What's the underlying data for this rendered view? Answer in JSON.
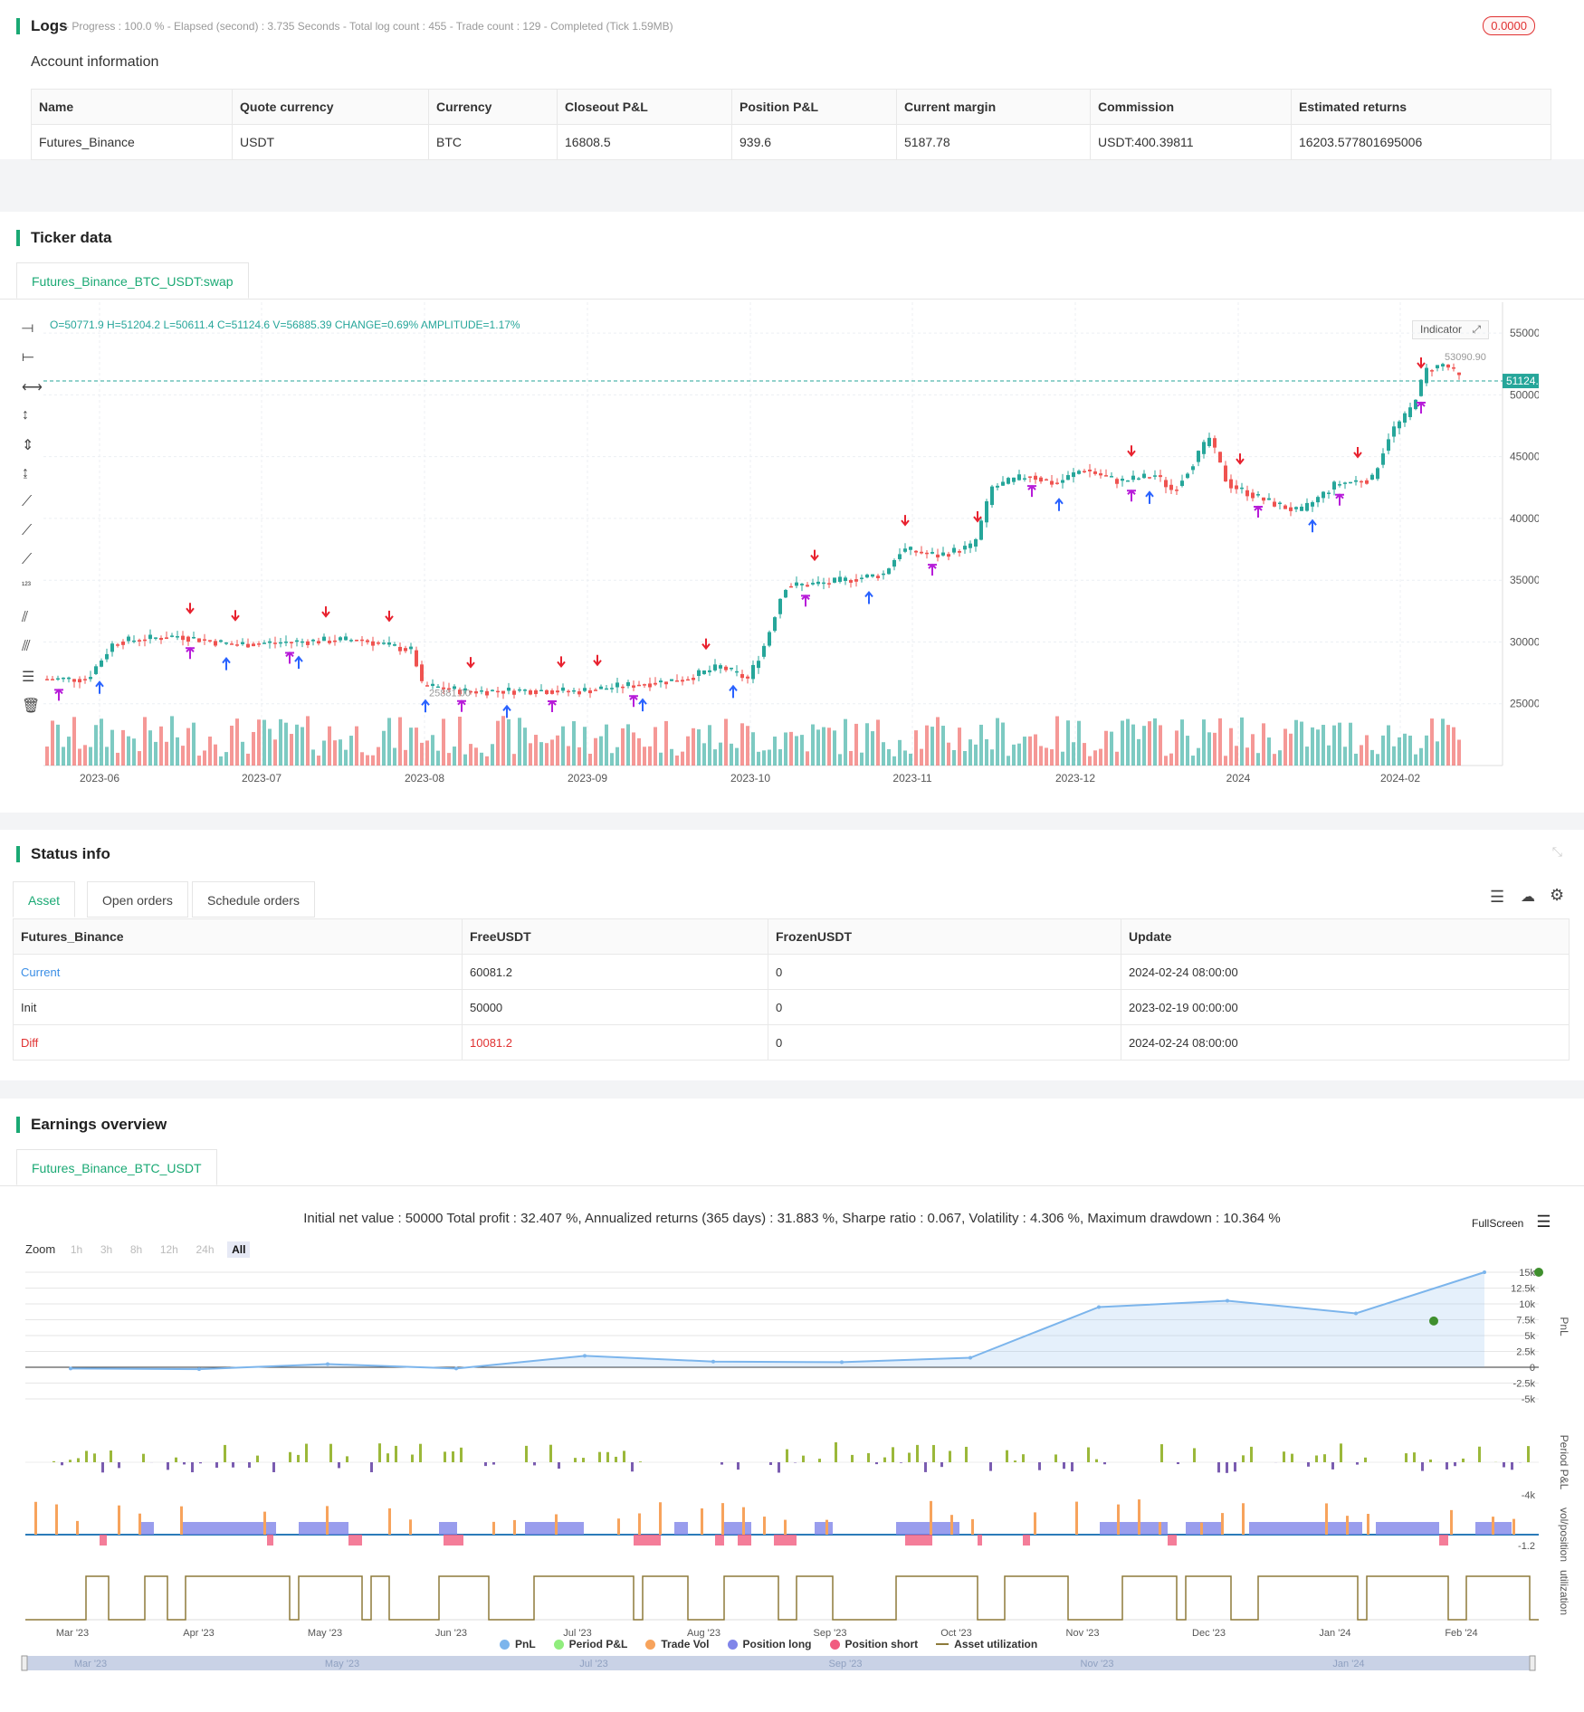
{
  "logs": {
    "title": "Logs",
    "status_line": "- Progress : 100.0 % - Elapsed (second) : 3.735 Seconds - Total log count : 455 - Trade count : 129 - Completed (Tick 1.59MB)",
    "badge": "0.0000"
  },
  "account": {
    "title": "Account information",
    "headers": [
      "Name",
      "Quote currency",
      "Currency",
      "Closeout P&L",
      "Position P&L",
      "Current margin",
      "Commission",
      "Estimated returns"
    ],
    "row": [
      "Futures_Binance",
      "USDT",
      "BTC",
      "16808.5",
      "939.6",
      "5187.78",
      "USDT:400.39811",
      "16203.577801695006"
    ]
  },
  "ticker": {
    "title": "Ticker data",
    "tab": "Futures_Binance_BTC_USDT:swap",
    "ohlc": "O=50771.9 H=51204.2 L=50611.4 C=51124.6 V=56885.39 CHANGE=0.69% AMPLITUDE=1.17%",
    "indicator_btn": "Indicator",
    "last_price": "51124.60",
    "high_label": "53090.90",
    "low_label": "25881.00",
    "y_ticks": [
      "55000.00",
      "50000.00",
      "45000.00",
      "40000.00",
      "35000.00",
      "30000.00",
      "25000.00"
    ],
    "x_ticks": [
      "2023-06",
      "2023-07",
      "2023-08",
      "2023-09",
      "2023-10",
      "2023-11",
      "2023-12",
      "2024",
      "2024-02"
    ],
    "colors": {
      "up": "#26a69a",
      "down": "#ef5350",
      "short": "#e8212e",
      "long": "#2962ff",
      "close": "#b71cd9"
    }
  },
  "status": {
    "title": "Status info",
    "tabs": [
      "Asset",
      "Open orders",
      "Schedule orders"
    ],
    "headers": [
      "Futures_Binance",
      "FreeUSDT",
      "FrozenUSDT",
      "Update"
    ],
    "rows": [
      [
        "Current",
        "60081.2",
        "0",
        "2024-02-24 08:00:00"
      ],
      [
        "Init",
        "50000",
        "0",
        "2023-02-19 00:00:00"
      ],
      [
        "Diff",
        "10081.2",
        "0",
        "2024-02-24 08:00:00"
      ]
    ]
  },
  "earnings": {
    "title": "Earnings overview",
    "tab": "Futures_Binance_BTC_USDT",
    "summary": "Initial net value : 50000 Total profit : 32.407 %, Annualized returns (365 days) : 31.883 %, Sharpe ratio : 0.067, Volatility : 4.306 %, Maximum drawdown : 10.364 %",
    "fullscreen": "FullScreen",
    "zoom_label": "Zoom",
    "zoom_options": [
      "1h",
      "3h",
      "8h",
      "12h",
      "24h",
      "All"
    ],
    "pnl_ticks": [
      "15k",
      "12.5k",
      "10k",
      "7.5k",
      "5k",
      "2.5k",
      "0",
      "-2.5k",
      "-5k"
    ],
    "axis_titles": [
      "PnL",
      "Period P&L",
      "vol/position",
      "utilization"
    ],
    "period_tick": "-4k",
    "vol_tick": "-1.2",
    "x_ticks": [
      "Mar '23",
      "Apr '23",
      "May '23",
      "Jun '23",
      "Jul '23",
      "Aug '23",
      "Sep '23",
      "Oct '23",
      "Nov '23",
      "Dec '23",
      "Jan '24",
      "Feb '24"
    ],
    "nav_ticks": [
      "Mar '23",
      "May '23",
      "Jul '23",
      "Sep '23",
      "Nov '23",
      "Jan '24"
    ],
    "legend": [
      {
        "name": "PnL",
        "color": "#7cb5ec"
      },
      {
        "name": "Period P&L",
        "color": "#90ed7d"
      },
      {
        "name": "Trade Vol",
        "color": "#f7a35c"
      },
      {
        "name": "Position long",
        "color": "#8085e9"
      },
      {
        "name": "Position short",
        "color": "#f15c80"
      },
      {
        "name": "Asset utilization",
        "color": "#8d7a3a"
      }
    ]
  },
  "chart_data": {
    "type": "line",
    "x": [
      "Mar '23",
      "Apr '23",
      "May '23",
      "Jun '23",
      "Jul '23",
      "Aug '23",
      "Sep '23",
      "Oct '23",
      "Nov '23",
      "Dec '23",
      "Jan '24",
      "Feb '24"
    ],
    "series": [
      {
        "name": "PnL",
        "values": [
          -200,
          -300,
          500,
          -200,
          1800,
          900,
          800,
          1500,
          9500,
          10500,
          8500,
          15000
        ]
      }
    ],
    "ylim": [
      -5000,
      15000
    ]
  }
}
